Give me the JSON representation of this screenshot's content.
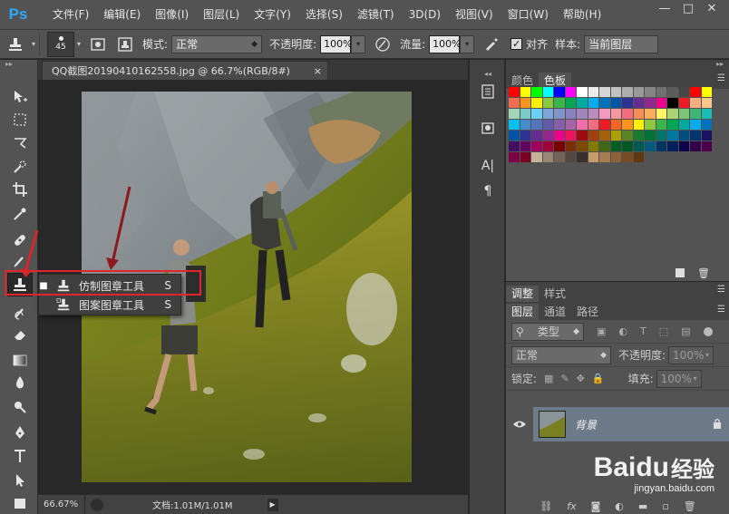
{
  "app": {
    "logo": "Ps",
    "menu": [
      "文件(F)",
      "编辑(E)",
      "图像(I)",
      "图层(L)",
      "文字(Y)",
      "选择(S)",
      "滤镜(T)",
      "3D(D)",
      "视图(V)",
      "窗口(W)",
      "帮助(H)"
    ],
    "window_buttons": [
      "—",
      "□",
      "✕"
    ]
  },
  "options": {
    "brush_size": "45",
    "mode_label": "模式:",
    "mode_value": "正常",
    "opacity_label": "不透明度:",
    "opacity_value": "100%",
    "flow_label": "流量:",
    "flow_value": "100%",
    "aligned_label": "对齐",
    "sample_label": "样本:",
    "sample_value": "当前图层"
  },
  "document": {
    "tab_title": "QQ截图20190410162558.jpg @ 66.7%(RGB/8#)",
    "tab_close": "×",
    "zoom": "66.67%",
    "doc_info": "文档:1.01M/1.01M"
  },
  "flyout": {
    "items": [
      {
        "label": "仿制图章工具",
        "key": "S",
        "selected": true
      },
      {
        "label": "图案图章工具",
        "key": "S",
        "selected": false
      }
    ]
  },
  "swatches_panel": {
    "tabs": [
      "颜色",
      "色板"
    ],
    "active_tab": "色板"
  },
  "adjust_panel": {
    "tabs": [
      "调整",
      "样式"
    ]
  },
  "layers_panel": {
    "tabs": [
      "图层",
      "通道",
      "路径"
    ],
    "filter_label": "类型",
    "blend_mode": "正常",
    "opacity_label": "不透明度:",
    "opacity_value": "100%",
    "lock_label": "锁定:",
    "fill_label": "填充:",
    "fill_value": "100%",
    "layer_name": "背景"
  },
  "watermark": {
    "brand": "Baidu",
    "suffix": "经验",
    "url": "jingyan.baidu.com"
  },
  "colors": {
    "accent": "#31a8ff",
    "highlight_box": "#e2242b",
    "selected_layer": "#6d7a8a"
  }
}
